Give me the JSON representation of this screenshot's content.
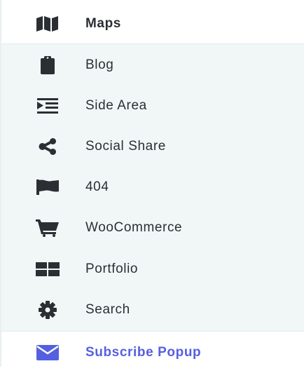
{
  "menu": {
    "items": [
      {
        "label": "Maps",
        "icon": "map-icon"
      },
      {
        "label": "Blog",
        "icon": "clipboard-icon"
      },
      {
        "label": "Side Area",
        "icon": "indent-list-icon"
      },
      {
        "label": "Social Share",
        "icon": "share-icon"
      },
      {
        "label": "404",
        "icon": "flag-icon"
      },
      {
        "label": "WooCommerce",
        "icon": "shopping-cart-icon"
      },
      {
        "label": "Portfolio",
        "icon": "grid-icon"
      },
      {
        "label": "Search",
        "icon": "gear-icon"
      },
      {
        "label": "Subscribe Popup",
        "icon": "envelope-icon"
      }
    ]
  },
  "colors": {
    "text": "#2b2f33",
    "icon": "#2b2f33",
    "active": "#5560e0",
    "submenu_bg": "#f1f7f7"
  }
}
